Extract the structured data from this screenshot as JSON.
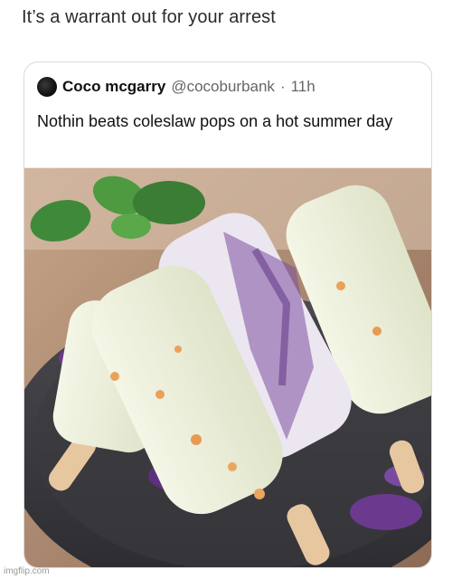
{
  "caption": "It’s a warrant out for your arrest",
  "tweet": {
    "display_name": "Coco mcgarry",
    "handle": "@cocoburbank",
    "separator": "·",
    "time": "11h",
    "text": "Nothin beats coleslaw pops on a hot summer day"
  },
  "media": {
    "alt_icon": "popsicle-photo-icon"
  },
  "watermark": "imgflip.com"
}
